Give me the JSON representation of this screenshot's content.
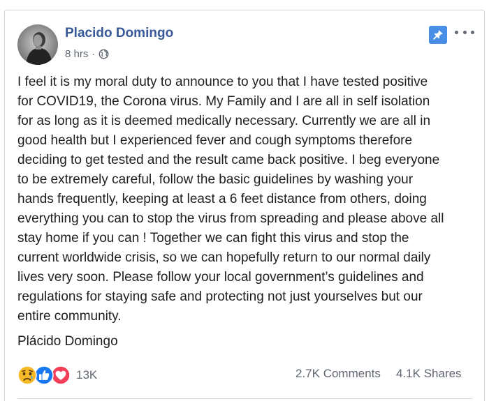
{
  "post": {
    "author": "Placido Domingo",
    "timestamp": "8 hrs",
    "separator": "·",
    "privacy_icon": "globe-icon",
    "body": "I feel it is my moral duty to announce to you that I have tested positive\nfor COVID19, the Corona virus. My Family and I are all in self isolation\nfor as long as it is deemed medically necessary. Currently we are all in\ngood health but I experienced fever and cough symptoms therefore\ndeciding to get tested and the result came back positive. I beg everyone\nto be extremely careful, follow the basic guidelines by washing your\nhands frequently, keeping at least a 6 feet distance from others, doing\neverything you can to stop the virus from spreading and please above all\nstay home if you can ! Together we can fight this virus and stop the\ncurrent worldwide crisis, so we can hopefully return to our normal daily\nlives very soon. Please follow your local government’s guidelines and\nregulations for staying safe and protecting not just yourselves but our\nentire community.",
    "signature": "Plácido Domingo"
  },
  "engagement": {
    "reaction_icons": [
      "sad-icon",
      "like-icon",
      "love-icon"
    ],
    "reactions_count": "13K",
    "comments": "2.7K Comments",
    "shares": "4.1K Shares"
  },
  "colors": {
    "author_link": "#385898",
    "secondary_text": "#606770",
    "pin_background": "#4a8fe7",
    "like_blue": "#1877f2",
    "love_red": "#f33e58",
    "sad_yellow": "#f7b928"
  }
}
